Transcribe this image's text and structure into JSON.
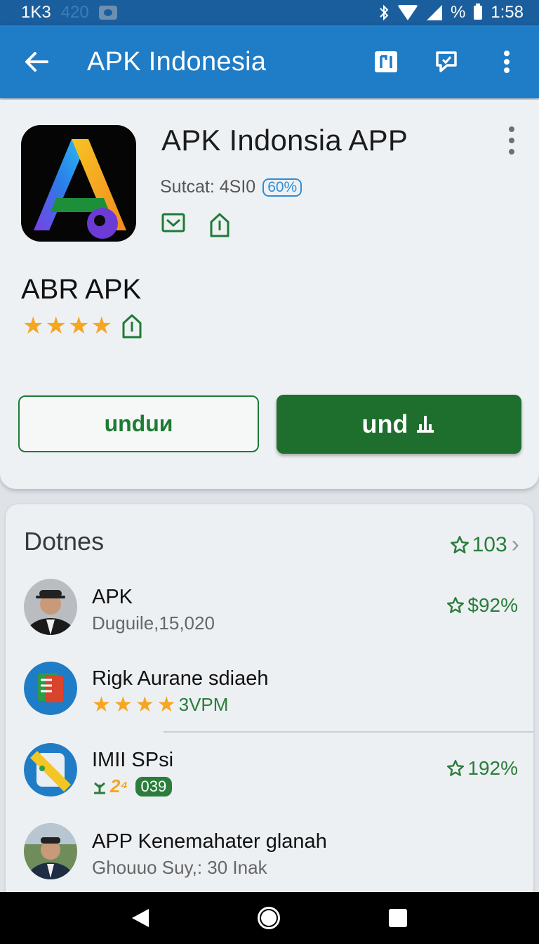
{
  "status_bar": {
    "left_text": "1K3",
    "faint_text": "420",
    "percent": "%",
    "time": "1:58"
  },
  "app_bar": {
    "title": "APK Indonesia",
    "back_icon": "arrow-left-icon",
    "action_icons": [
      "tablet-icon",
      "chat-icon",
      "more-vert-icon"
    ]
  },
  "app": {
    "name": "APK Indonsia APP",
    "subtitle": "Sutcat: 4SI0",
    "badge": "60%",
    "section_title": "ABR APK",
    "rating_stars": 4,
    "outline_button_label": "unduᴎ",
    "filled_button_label": "und"
  },
  "list": {
    "title": "Dotnes",
    "count": "103",
    "items": [
      {
        "title": "APK",
        "subtitle": "Duguile,15,020",
        "meta": "$92%"
      },
      {
        "title": "Rigk Aurane sdiaeh",
        "stars": 4,
        "sub_text": "3VPM"
      },
      {
        "title": "IMII SPsi",
        "sub_text": "2⁴",
        "pill": "039",
        "meta": "192%"
      },
      {
        "title": "APP Kenemahater glanah",
        "subtitle": "Ghouuo Suy,: 30 Inak"
      }
    ]
  },
  "colors": {
    "app_bar": "#1f7cc6",
    "status_bar": "#1a5e9e",
    "accent_green": "#1e6f2e",
    "star": "#f5a623"
  }
}
